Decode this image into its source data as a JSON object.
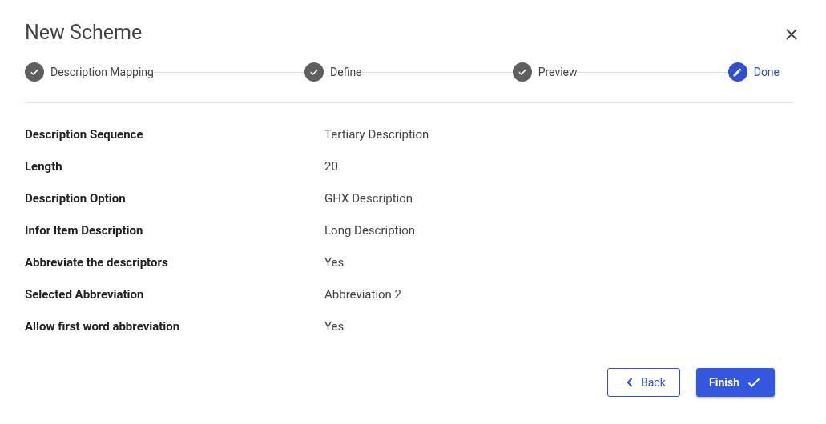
{
  "dialog": {
    "title": "New Scheme"
  },
  "steps": [
    {
      "label": "Description Mapping",
      "kind": "complete"
    },
    {
      "label": "Define",
      "kind": "complete"
    },
    {
      "label": "Preview",
      "kind": "complete"
    },
    {
      "label": "Done",
      "kind": "current"
    }
  ],
  "details": [
    {
      "label": "Description Sequence",
      "value": "Tertiary Description"
    },
    {
      "label": "Length",
      "value": "20"
    },
    {
      "label": "Description Option",
      "value": "GHX Description"
    },
    {
      "label": "Infor Item Description",
      "value": "Long Description"
    },
    {
      "label": "Abbreviate the descriptors",
      "value": "Yes"
    },
    {
      "label": "Selected Abbreviation",
      "value": "Abbreviation 2"
    },
    {
      "label": "Allow first word abbreviation",
      "value": "Yes"
    }
  ],
  "buttons": [
    {
      "label": "Back",
      "kind": "back"
    },
    {
      "label": "Finish",
      "kind": "finish"
    }
  ]
}
